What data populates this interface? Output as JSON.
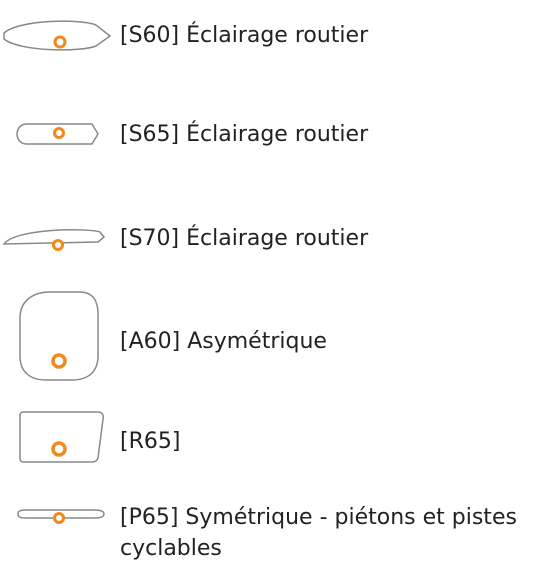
{
  "lighting_options": [
    {
      "code": "[S60]",
      "label": "[S60] Éclairage routier"
    },
    {
      "code": "[S65]",
      "label": "[S65] Éclairage routier"
    },
    {
      "code": "[S70]",
      "label": "[S70] Éclairage routier"
    },
    {
      "code": "[A60]",
      "label": "[A60] Asymétrique"
    },
    {
      "code": "[R65]",
      "label": "[R65]"
    },
    {
      "code": "[P65]",
      "label": "[P65] Symétrique - piétons et pistes cyclables"
    }
  ],
  "colors": {
    "outline": "#888888",
    "accent": "#f08a1c",
    "text": "#222222"
  },
  "icons": [
    "light-distribution-s60-icon",
    "light-distribution-s65-icon",
    "light-distribution-s70-icon",
    "light-distribution-a60-icon",
    "light-distribution-r65-icon",
    "light-distribution-p65-icon"
  ]
}
